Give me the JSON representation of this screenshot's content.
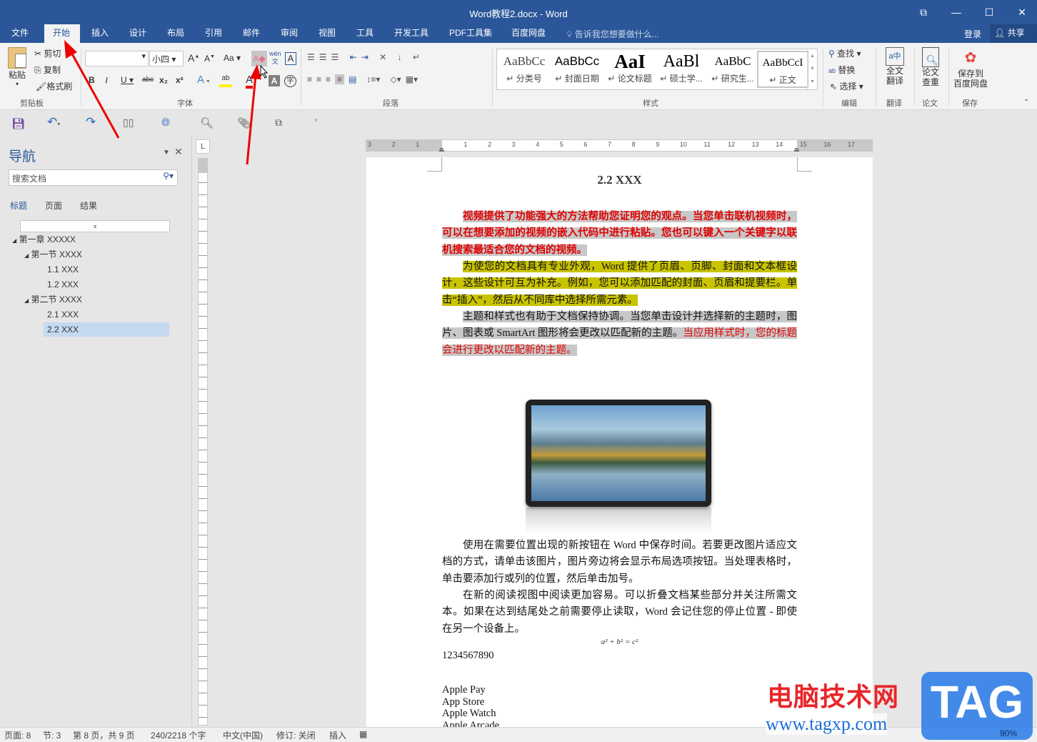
{
  "window": {
    "title": "Word教程2.docx - Word",
    "controls": [
      "⧉",
      "—",
      "☐",
      "✕"
    ]
  },
  "tabs": [
    "文件",
    "开始",
    "插入",
    "设计",
    "布局",
    "引用",
    "邮件",
    "审阅",
    "视图",
    "工具",
    "开发工具",
    "PDF工具集",
    "百度网盘"
  ],
  "tell_me": "告诉我您想要做什么...",
  "login": "登录",
  "share": "共享",
  "ribbon": {
    "clipboard": {
      "paste": "粘贴",
      "cut": "剪切",
      "copy": "复制",
      "painter": "格式刷",
      "label": "剪贴板"
    },
    "font": {
      "name": "",
      "size": "小四",
      "label": "字体",
      "bold": "B",
      "italic": "I",
      "underline": "U",
      "strike": "abc",
      "sub": "x₂",
      "sup": "x²",
      "case": "Aa",
      "grow": "A",
      "shrink": "A",
      "pinyin": "wén",
      "enclose": "字"
    },
    "paragraph": {
      "label": "段落"
    },
    "styles": {
      "label": "样式",
      "items": [
        {
          "preview": "AaBbCc",
          "name": "分类号"
        },
        {
          "preview": "AaBbCc",
          "name": "封面日期"
        },
        {
          "preview": "AaI",
          "name": "论文标题"
        },
        {
          "preview": "AaBl",
          "name": "硕士学..."
        },
        {
          "preview": "AaBbC",
          "name": "研究生..."
        },
        {
          "preview": "AaBbCcI",
          "name": "正文"
        }
      ]
    },
    "editing": {
      "find": "查找",
      "replace": "替换",
      "select": "选择",
      "label": "编辑"
    },
    "translate": {
      "button": "全文\n翻译",
      "label": "翻译"
    },
    "paper": {
      "button": "论文\n查重",
      "label": "论文"
    },
    "save": {
      "button": "保存到\n百度网盘",
      "label": "保存"
    }
  },
  "nav": {
    "title": "导航",
    "search_placeholder": "搜索文档",
    "tabs": [
      "标题",
      "页面",
      "结果"
    ],
    "tree": [
      {
        "label": "第一章 XXXXX",
        "level": 0
      },
      {
        "label": "第一节 XXXX",
        "level": 1
      },
      {
        "label": "1.1 XXX",
        "level": 2
      },
      {
        "label": "1.2 XXX",
        "level": 2
      },
      {
        "label": "第二节 XXXX",
        "level": 1
      },
      {
        "label": "2.1 XXX",
        "level": 2
      },
      {
        "label": "2.2 XXX",
        "level": 2,
        "selected": true
      }
    ]
  },
  "ruler": {
    "labels": [
      "3",
      "2",
      "1",
      "",
      "1",
      "2",
      "3",
      "4",
      "5",
      "6",
      "7",
      "8",
      "9",
      "10",
      "11",
      "12",
      "13",
      "14",
      "15",
      "16",
      "17"
    ]
  },
  "document": {
    "heading": "2.2 XXX",
    "p1": "视频提供了功能强大的方法帮助您证明您的观点。当您单击联机视频时，可以在想要添加的视频的嵌入代码中进行粘贴。您也可以键入一个关键字以联机搜索最适合您的文档的视频。",
    "p2": "为使您的文档具有专业外观，Word 提供了页眉、页脚、封面和文本框设计，这些设计可互为补充。例如，您可以添加匹配的封面、页眉和提要栏。单击“插入”，然后从不同库中选择所需元素。",
    "p3a": "主题和样式也有助于文档保持协调。当您单击设计并选择新的主题时，图片、图表或 SmartArt 图形将会更改以匹配新的主题。",
    "p3b": "当应用样式时，您的标题会进行更改以匹配新的主题。",
    "p4": "使用在需要位置出现的新按钮在 Word 中保存时间。若要更改图片适应文档的方式，请单击该图片，图片旁边将会显示布局选项按钮。当处理表格时，单击要添加行或列的位置，然后单击加号。",
    "p5": "在新的阅读视图中阅读更加容易。可以折叠文档某些部分并关注所需文本。如果在达到结尾处之前需要停止读取，Word 会记住您的停止位置 - 即使在另一个设备上。",
    "formula": "a² + b² = c²",
    "digits": "1234567890",
    "list": [
      "Apple Pay",
      "App Store",
      "Apple Watch",
      "Apple Arcade"
    ]
  },
  "status": {
    "page": "页面: 8",
    "section": "节: 3",
    "pages": "第 8 页，共 9 页",
    "words": "240/2218 个字",
    "lang": "中文(中国)",
    "track": "修订: 关闭",
    "mode": "插入",
    "zoom": "90%"
  },
  "watermark": {
    "cn": "电脑技术网",
    "url": "www.tagxp.com",
    "tag": "TAG"
  }
}
